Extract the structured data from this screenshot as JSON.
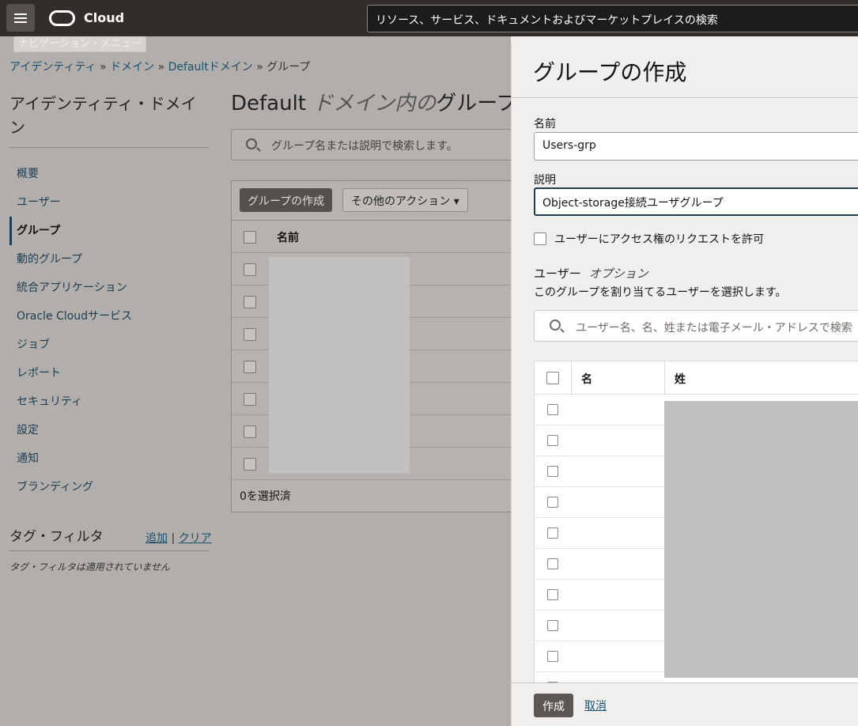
{
  "topbar": {
    "brand": "Cloud",
    "search_placeholder": "リソース、サービス、ドキュメントおよびマーケットプレイスの検索"
  },
  "tooltip": "ナビゲーション・メニュー",
  "breadcrumb": {
    "items": [
      "アイデンティティ",
      "ドメイン",
      "Defaultドメイン"
    ],
    "current": "グループ",
    "separator": "»"
  },
  "sidebar": {
    "title": "アイデンティティ・ドメイン",
    "items": [
      {
        "label": "概要"
      },
      {
        "label": "ユーザー"
      },
      {
        "label": "グループ"
      },
      {
        "label": "動的グループ"
      },
      {
        "label": "統合アプリケーション"
      },
      {
        "label": "Oracle Cloudサービス"
      },
      {
        "label": "ジョブ"
      },
      {
        "label": "レポート"
      },
      {
        "label": "セキュリティ"
      },
      {
        "label": "設定"
      },
      {
        "label": "通知"
      },
      {
        "label": "ブランディング"
      }
    ],
    "active_index": 2,
    "tag_filter": {
      "title": "タグ・フィルタ",
      "add": "追加",
      "separator": "|",
      "clear": "クリア",
      "none": "タグ・フィルタは適用されていません"
    }
  },
  "main": {
    "title_prefix": "Default",
    "title_italic": "ドメイン内の",
    "title_suffix": "グループ",
    "search_placeholder": "グループ名または説明で検索します。",
    "create_button": "グループの作成",
    "more_actions": "その他のアクション",
    "column_name": "名前",
    "selected_count": "0を選択済"
  },
  "panel": {
    "title": "グループの作成",
    "name_label": "名前",
    "name_value": "Users-grp",
    "description_label": "説明",
    "description_value": "Object-storage接続ユーザグループ",
    "allow_request_label": "ユーザーにアクセス権のリクエストを許可",
    "users_label": "ユーザー",
    "users_optional": "オプション",
    "users_help": "このグループを割り当てるユーザーを選択します。",
    "user_search_placeholder": "ユーザー名、名、姓または電子メール・アドレスで検索",
    "col_first_name": "名",
    "col_last_name": "姓",
    "create_button": "作成",
    "cancel_button": "取消"
  }
}
